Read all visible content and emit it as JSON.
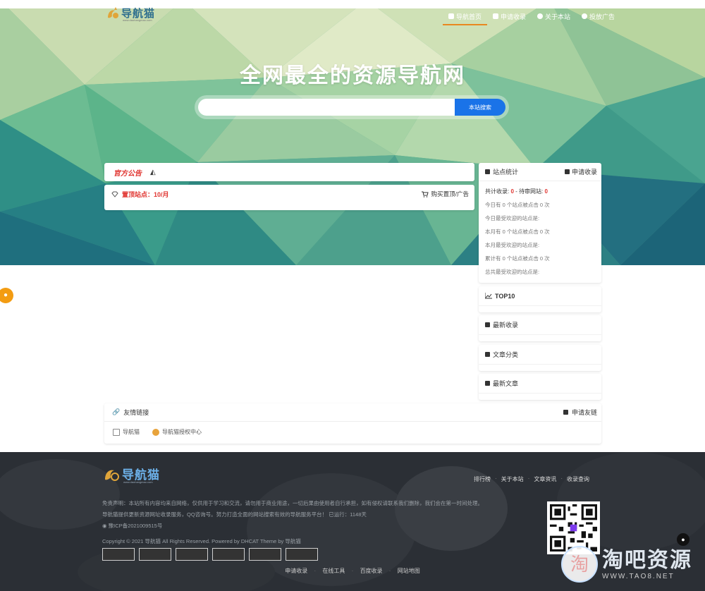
{
  "header": {
    "logo_text": "导航猫",
    "logo_sub": "www.daohangmao.com",
    "nav": [
      {
        "label": "导航首页",
        "active": true
      },
      {
        "label": "申请收录",
        "active": false
      },
      {
        "label": "关于本站",
        "active": false
      },
      {
        "label": "投放广告",
        "active": false
      }
    ]
  },
  "hero": {
    "title": "全网最全的资源导航网",
    "search_placeholder": "",
    "search_button": "本站搜索"
  },
  "notice": {
    "label": "官方公告",
    "icon": "megaphone-icon"
  },
  "ad": {
    "left": "置顶站点：10/月",
    "right": "购买置顶/广告"
  },
  "stats": {
    "title": "站点统计",
    "apply": "申请收录",
    "total_label": "共计收录:",
    "total_value": "0",
    "sep": "-",
    "pending_label": "待审网站:",
    "pending_value": "0",
    "rows": [
      "今日有 0 个站点被点击 0 次",
      "今日最受欢迎的站点是:",
      "本月有 0 个站点被点击 0 次",
      "本月最受欢迎的站点是:",
      "累计有 0 个站点被点击 0 次",
      "总共最受欢迎的站点是:"
    ]
  },
  "widgets": [
    {
      "label": "TOP10",
      "icon": "chart-icon"
    },
    {
      "label": "最新收录",
      "icon": "book-icon"
    },
    {
      "label": "文章分类",
      "icon": "folder-icon"
    },
    {
      "label": "最新文章",
      "icon": "pen-icon"
    }
  ],
  "links": {
    "title": "友情链接",
    "apply": "申请友链",
    "items": [
      "导航猫",
      "导航猫授权中心"
    ]
  },
  "footer": {
    "logo_text": "导航猫",
    "logo_sub": "www.daohangmao.com",
    "nav": [
      "排行榜",
      "关于本站",
      "文章资讯",
      "收录查询"
    ],
    "lines": [
      "免责声明：本站所有内容均来自网络，仅供用于学习和交流，请勿用于商业用途，一切后果由使用者自行承担，如有侵权请联系我们删除，我们会在第一时间处理。",
      "导航猫提供更新资源网址收录服务，QQ咨询号。努力打造全面的网站搜索有效的导航服务平台！ 已运行：1148天"
    ],
    "icp": "豫ICP备2021009515号",
    "copyright": "Copyright © 2021 导航猫 All Rights Reserved. Powered by DHCAT Theme by 导航猫",
    "bottom": [
      "申请收录",
      "在线工具",
      "百度收录",
      "网站地图"
    ]
  },
  "watermark": {
    "big": "淘吧资源",
    "small": "WWW.TAO8.NET",
    "circle_char": "淘"
  },
  "colors": {
    "accent_blue": "#1a73e8",
    "accent_red": "#e0342f",
    "nav_underline": "#e8881f",
    "footer_bg": "#2a2e33"
  }
}
